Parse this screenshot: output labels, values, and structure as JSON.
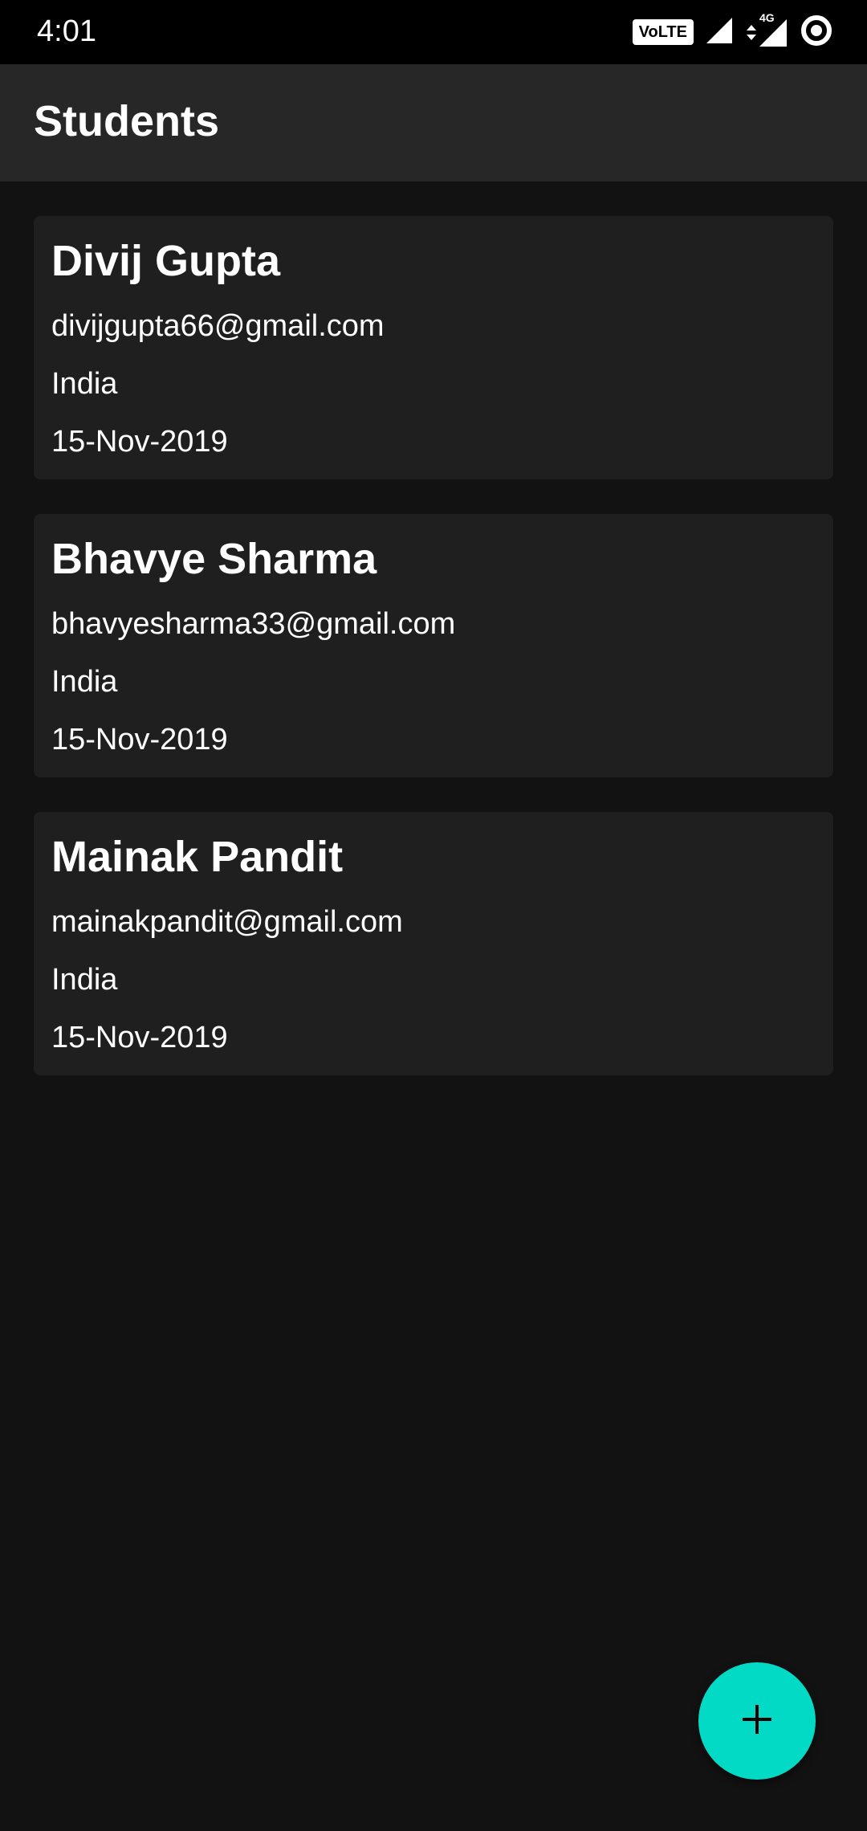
{
  "status_bar": {
    "time": "4:01",
    "volte_label": "VoLTE",
    "network_label": "4G",
    "icons": [
      "volte-icon",
      "signal-icon",
      "data-arrows-icon",
      "signal-4g-icon",
      "battery-ring-icon"
    ]
  },
  "app_bar": {
    "title": "Students"
  },
  "students": [
    {
      "name": "Divij Gupta",
      "email": "divijgupta66@gmail.com",
      "country": "India",
      "date": "15-Nov-2019"
    },
    {
      "name": "Bhavye Sharma",
      "email": "bhavyesharma33@gmail.com",
      "country": "India",
      "date": "15-Nov-2019"
    },
    {
      "name": "Mainak Pandit",
      "email": "mainakpandit@gmail.com",
      "country": "India",
      "date": "15-Nov-2019"
    }
  ],
  "fab": {
    "icon": "plus-icon",
    "color": "#03dac5"
  },
  "colors": {
    "background": "#121212",
    "app_bar": "#272727",
    "card": "#1f1f1f",
    "status_bar": "#000000",
    "accent": "#03dac5"
  }
}
